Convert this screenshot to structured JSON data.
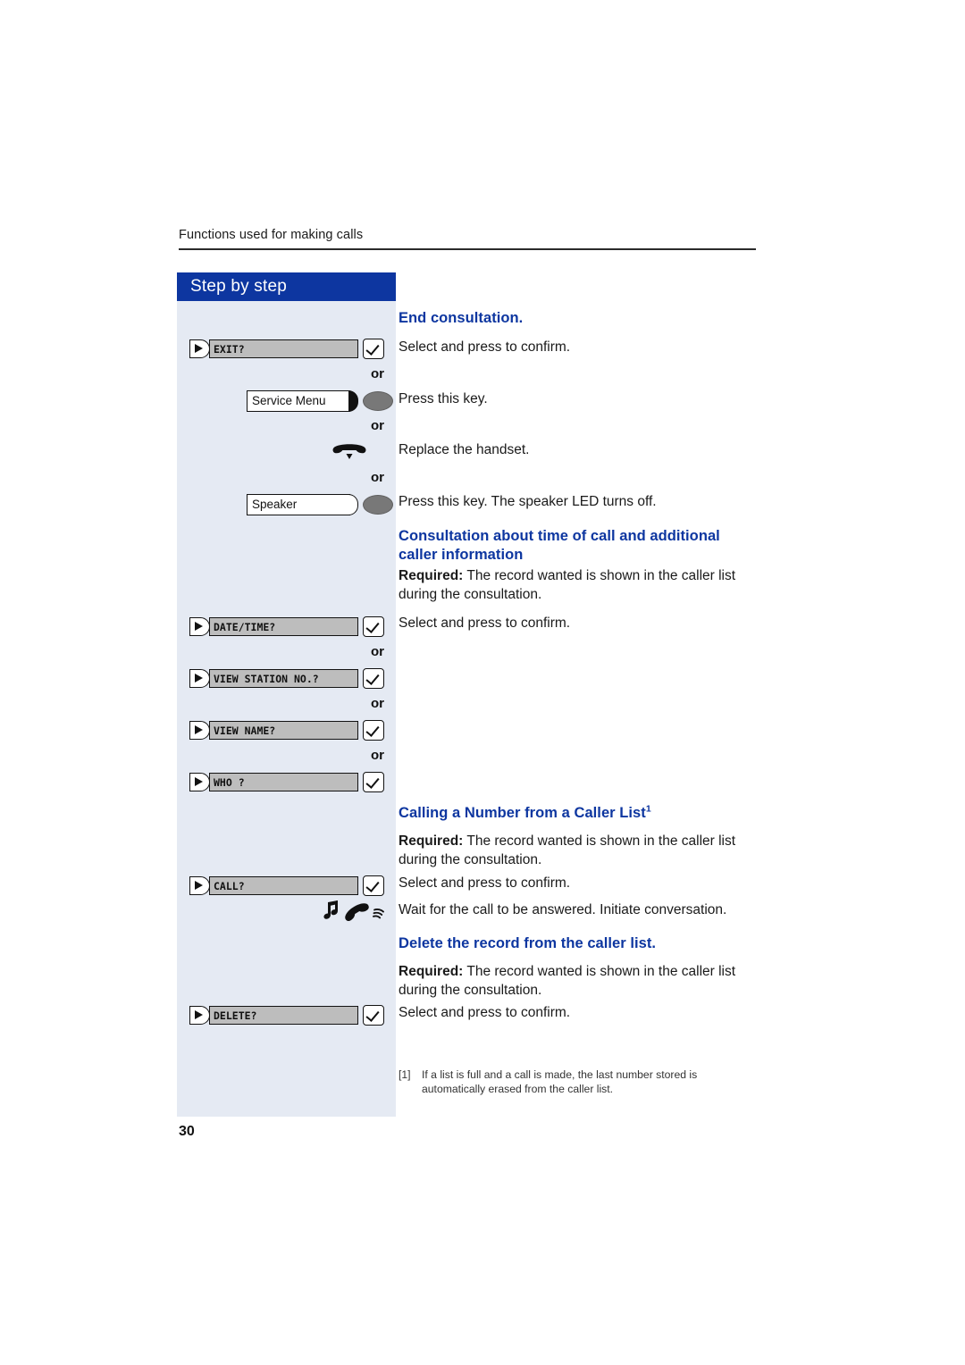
{
  "page": {
    "running_head": "Functions used for making calls",
    "folio": "30",
    "accent_blue": "#0d36a0",
    "sidebar_bg": "#e5eaf3",
    "field_grey": "#bdbdbd"
  },
  "sidebar": {
    "title": "Step by step",
    "or_label": "or",
    "steps": [
      {
        "kind": "menu-option",
        "label": "EXIT?",
        "icon_left": "select-arrow-icon",
        "icon_right": "confirm-check-icon"
      },
      {
        "kind": "function-key",
        "label": "Service Menu",
        "lens": "filled",
        "icon": "service-menu-key-icon"
      },
      {
        "kind": "handset",
        "icon": "replace-handset-icon"
      },
      {
        "kind": "function-key",
        "label": "Speaker",
        "lens": "hollow",
        "icon": "speaker-key-icon"
      },
      {
        "kind": "menu-option",
        "label": "DATE/TIME?",
        "icon_left": "select-arrow-icon",
        "icon_right": "confirm-check-icon"
      },
      {
        "kind": "menu-option",
        "label": "VIEW STATION NO.?",
        "icon_left": "select-arrow-icon",
        "icon_right": "confirm-check-icon"
      },
      {
        "kind": "menu-option",
        "label": "VIEW NAME?",
        "icon_left": "select-arrow-icon",
        "icon_right": "confirm-check-icon"
      },
      {
        "kind": "menu-option",
        "label": "WHO ?",
        "icon_left": "select-arrow-icon",
        "icon_right": "confirm-check-icon"
      },
      {
        "kind": "menu-option",
        "label": "CALL?",
        "icon_left": "select-arrow-icon",
        "icon_right": "confirm-check-icon"
      },
      {
        "kind": "ringing",
        "icon": "ringing-handset-icon"
      },
      {
        "kind": "menu-option",
        "label": "DELETE?",
        "icon_left": "select-arrow-icon",
        "icon_right": "confirm-check-icon"
      }
    ]
  },
  "content": {
    "heading_end_consultation": "End consultation.",
    "text_select_confirm_1": "Select and press to confirm.",
    "text_press_key": "Press this key.",
    "text_replace_handset": "Replace the handset.",
    "text_press_key_speaker": "Press this key. The speaker LED turns off.",
    "heading_consultation_time": "Consultation about time of call and additional caller information",
    "required_label_1": "Required:",
    "required_text_1": " The record wanted is shown in the caller list during the consultation.",
    "text_select_confirm_2": "Select and press to confirm.",
    "heading_calling_number": "Calling a Number from a Caller List",
    "heading_calling_number_sup": "1",
    "required_label_2": "Required:",
    "required_text_2": " The record wanted is shown in the caller list during the consultation.",
    "text_select_confirm_3": "Select and press to confirm.",
    "text_wait_for_call": "Wait for the call to be answered. Initiate conversation.",
    "heading_delete_record": "Delete the record from the caller list.",
    "required_label_3": "Required:",
    "required_text_3": " The record wanted is shown in the caller list during the consultation.",
    "text_select_confirm_4": "Select and press to confirm."
  },
  "footnote": {
    "marker": "[1]",
    "text": "If a list is full and a call is made, the last number stored is automatically erased from the caller list."
  }
}
